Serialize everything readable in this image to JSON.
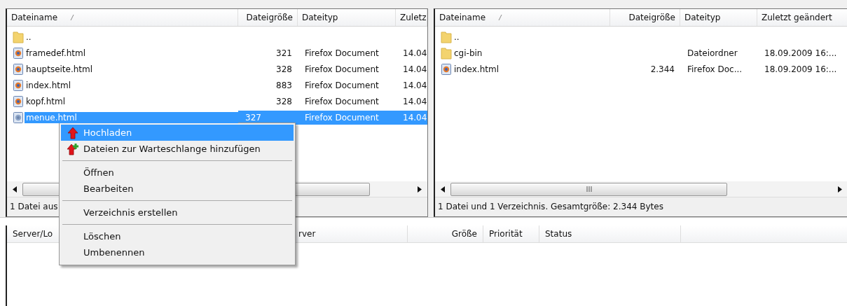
{
  "panes": [
    {
      "columns": [
        {
          "label": "Dateiname",
          "sorted": true
        },
        {
          "label": "Dateigröße",
          "sorted": false
        },
        {
          "label": "Dateityp",
          "sorted": false
        },
        {
          "label": "Zuletz",
          "sorted": false
        }
      ],
      "rows": [
        {
          "kind": "folder",
          "name": "..",
          "size": "",
          "type": "",
          "modified": "",
          "selected": false
        },
        {
          "kind": "file",
          "name": "framedef.html",
          "size": "321",
          "type": "Firefox Document",
          "modified": "14.04",
          "selected": false
        },
        {
          "kind": "file",
          "name": "hauptseite.html",
          "size": "328",
          "type": "Firefox Document",
          "modified": "14.04",
          "selected": false
        },
        {
          "kind": "file",
          "name": "index.html",
          "size": "883",
          "type": "Firefox Document",
          "modified": "14.04",
          "selected": false
        },
        {
          "kind": "file",
          "name": "kopf.html",
          "size": "328",
          "type": "Firefox Document",
          "modified": "14.04",
          "selected": false
        },
        {
          "kind": "file",
          "name": "menue.html",
          "size": "327",
          "type": "Firefox Document",
          "modified": "14.04",
          "selected": true
        }
      ],
      "status": "1 Datei aus"
    },
    {
      "columns": [
        {
          "label": "Dateiname",
          "sorted": true
        },
        {
          "label": "Dateigröße",
          "sorted": false
        },
        {
          "label": "Dateityp",
          "sorted": false
        },
        {
          "label": "Zuletzt geändert",
          "sorted": false
        }
      ],
      "rows": [
        {
          "kind": "folder",
          "name": "..",
          "size": "",
          "type": "",
          "modified": "",
          "selected": false
        },
        {
          "kind": "folder",
          "name": "cgi-bin",
          "size": "",
          "type": "Dateiordner",
          "modified": "18.09.2009 16:...",
          "selected": false
        },
        {
          "kind": "file",
          "name": "index.html",
          "size": "2.344",
          "type": "Firefox Doc...",
          "modified": "18.09.2009 16:...",
          "selected": false
        }
      ],
      "status": "1 Datei und 1 Verzeichnis. Gesamtgröße: 2.344 Bytes"
    }
  ],
  "queue": {
    "columns": [
      "Server/Lo",
      "rver",
      "Größe",
      "Priorität",
      "Status"
    ]
  },
  "context_menu": {
    "groups": [
      [
        {
          "label": "Hochladen",
          "kind": "upload",
          "selected": true
        },
        {
          "label": "Dateien zur Warteschlange hinzufügen",
          "kind": "queue",
          "selected": false
        }
      ],
      [
        {
          "label": "Öffnen",
          "kind": "plain",
          "selected": false
        },
        {
          "label": "Bearbeiten",
          "kind": "plain",
          "selected": false
        }
      ],
      [
        {
          "label": "Verzeichnis erstellen",
          "kind": "plain",
          "selected": false
        }
      ],
      [
        {
          "label": "Löschen",
          "kind": "plain",
          "selected": false
        },
        {
          "label": "Umbenennen",
          "kind": "plain",
          "selected": false
        }
      ]
    ]
  }
}
